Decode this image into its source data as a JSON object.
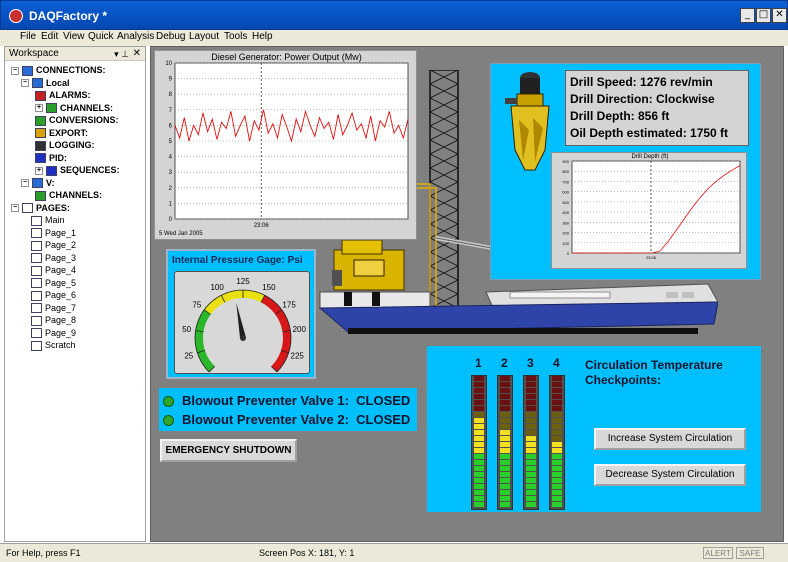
{
  "window": {
    "title": "DAQFactory *",
    "min_glyph": "_",
    "max_glyph": "□",
    "close_glyph": "✕"
  },
  "menu": [
    {
      "label": "File"
    },
    {
      "label": "Edit"
    },
    {
      "label": "View"
    },
    {
      "label": "Quick"
    },
    {
      "label": "Analysis"
    },
    {
      "label": "Debug"
    },
    {
      "label": "Layout"
    },
    {
      "label": "Tools"
    },
    {
      "label": "Help"
    }
  ],
  "workspace": {
    "header": "Workspace",
    "pin_glyph": "▾ ⊥",
    "close_glyph": "✕",
    "tree": [
      {
        "label": "CONNECTIONS:",
        "exp": "−",
        "bold": true
      },
      {
        "label": "Local",
        "exp": "−",
        "bold": true
      },
      {
        "label": "ALARMS:",
        "exp": "",
        "bold": true
      },
      {
        "label": "CHANNELS:",
        "exp": "+",
        "bold": true
      },
      {
        "label": "CONVERSIONS:",
        "exp": "",
        "bold": true
      },
      {
        "label": "EXPORT:",
        "exp": "",
        "bold": true
      },
      {
        "label": "LOGGING:",
        "exp": "",
        "bold": true
      },
      {
        "label": "PID:",
        "exp": "",
        "bold": true
      },
      {
        "label": "SEQUENCES:",
        "exp": "+",
        "bold": true
      },
      {
        "label": "V:",
        "exp": "−",
        "bold": true
      },
      {
        "label": "CHANNELS:",
        "exp": "",
        "bold": true
      },
      {
        "label": "PAGES:",
        "exp": "−",
        "bold": true
      },
      {
        "label": "Main",
        "exp": "",
        "bold": false
      },
      {
        "label": "Page_1",
        "exp": "",
        "bold": false
      },
      {
        "label": "Page_2",
        "exp": "",
        "bold": false
      },
      {
        "label": "Page_3",
        "exp": "",
        "bold": false
      },
      {
        "label": "Page_4",
        "exp": "",
        "bold": false
      },
      {
        "label": "Page_5",
        "exp": "",
        "bold": false
      },
      {
        "label": "Page_6",
        "exp": "",
        "bold": false
      },
      {
        "label": "Page_7",
        "exp": "",
        "bold": false
      },
      {
        "label": "Page_8",
        "exp": "",
        "bold": false
      },
      {
        "label": "Page_9",
        "exp": "",
        "bold": false
      },
      {
        "label": "Scratch",
        "exp": "",
        "bold": false
      }
    ]
  },
  "power_chart": {
    "title": "Diesel Generator: Power Output (Mw)",
    "date": "5 Wed Jan 2005",
    "x_tick": "23:06",
    "chart_data": {
      "type": "line",
      "title": "Diesel Generator: Power Output (Mw)",
      "ylim": [
        0,
        10
      ],
      "y_ticks": [
        "0",
        "1",
        "2",
        "3",
        "4",
        "5",
        "6",
        "7",
        "8",
        "9",
        "10"
      ],
      "x_tick_labels": [
        "23:06"
      ],
      "grid": true,
      "series": [
        {
          "values": [
            6.0,
            5.2,
            6.5,
            5.0,
            6.0,
            5.4,
            6.8,
            5.6,
            6.4,
            5.1,
            6.2,
            5.8,
            6.9,
            5.3,
            6.0,
            6.6,
            5.0,
            6.3,
            5.7,
            7.0,
            5.5,
            6.1,
            5.2,
            6.7,
            5.9,
            5.0,
            6.4,
            5.6,
            6.9,
            6.0,
            5.3,
            6.5,
            5.8,
            6.2,
            5.1,
            6.7,
            5.4,
            6.0,
            6.8,
            5.7,
            6.1,
            5.2,
            6.6,
            5.0,
            6.3,
            5.9,
            6.9,
            5.5,
            6.0,
            5.2,
            6.4
          ]
        }
      ]
    }
  },
  "gauge": {
    "title": "Internal Pressure Gage: Psi",
    "value": 115,
    "min": 0,
    "max": 250,
    "labels": [
      "0",
      "25",
      "50",
      "75",
      "100",
      "125",
      "150",
      "175",
      "200",
      "225",
      "250"
    ]
  },
  "valves": [
    {
      "label": "Blowout Preventer Valve 1:",
      "status": "CLOSED"
    },
    {
      "label": "Blowout Preventer Valve 2:",
      "status": "CLOSED"
    }
  ],
  "emergency_button": "EMERGENCY SHUTDOWN",
  "drill": {
    "speed": "Drill Speed: 1276 rev/min",
    "direction": "Drill Direction: Clockwise",
    "depth": "Drill Depth: 856 ft",
    "oil_depth": "Oil Depth estimated: 1750 ft"
  },
  "depth_chart": {
    "title": "Drill Depth (ft)",
    "x_tick": "23:06",
    "chart_data": {
      "type": "line",
      "title": "Drill Depth (ft)",
      "ylim": [
        0,
        900
      ],
      "y_ticks": [
        "0",
        "100",
        "200",
        "300",
        "400",
        "500",
        "600",
        "700",
        "800",
        "900"
      ],
      "x_tick_labels": [
        "23:06"
      ],
      "grid": true,
      "series": [
        {
          "values": [
            0,
            0,
            0,
            0,
            0,
            0,
            0,
            0,
            0,
            0,
            0,
            20,
            110,
            220,
            330,
            440,
            540,
            630,
            700,
            760,
            810,
            856
          ]
        }
      ]
    }
  },
  "circulation": {
    "title": "Circulation Temperature Checkpoints:",
    "checkpoints": [
      "1",
      "2",
      "3",
      "4"
    ],
    "levels": [
      0.7,
      0.6,
      0.55,
      0.5
    ],
    "increase_button": "Increase System Circulation",
    "decrease_button": "Decrease System Circulation"
  },
  "status": {
    "help": "For Help, press F1",
    "screen_pos": "Screen Pos X: 181, Y: 1",
    "alert": "ALERT",
    "safe": "SAFE"
  }
}
